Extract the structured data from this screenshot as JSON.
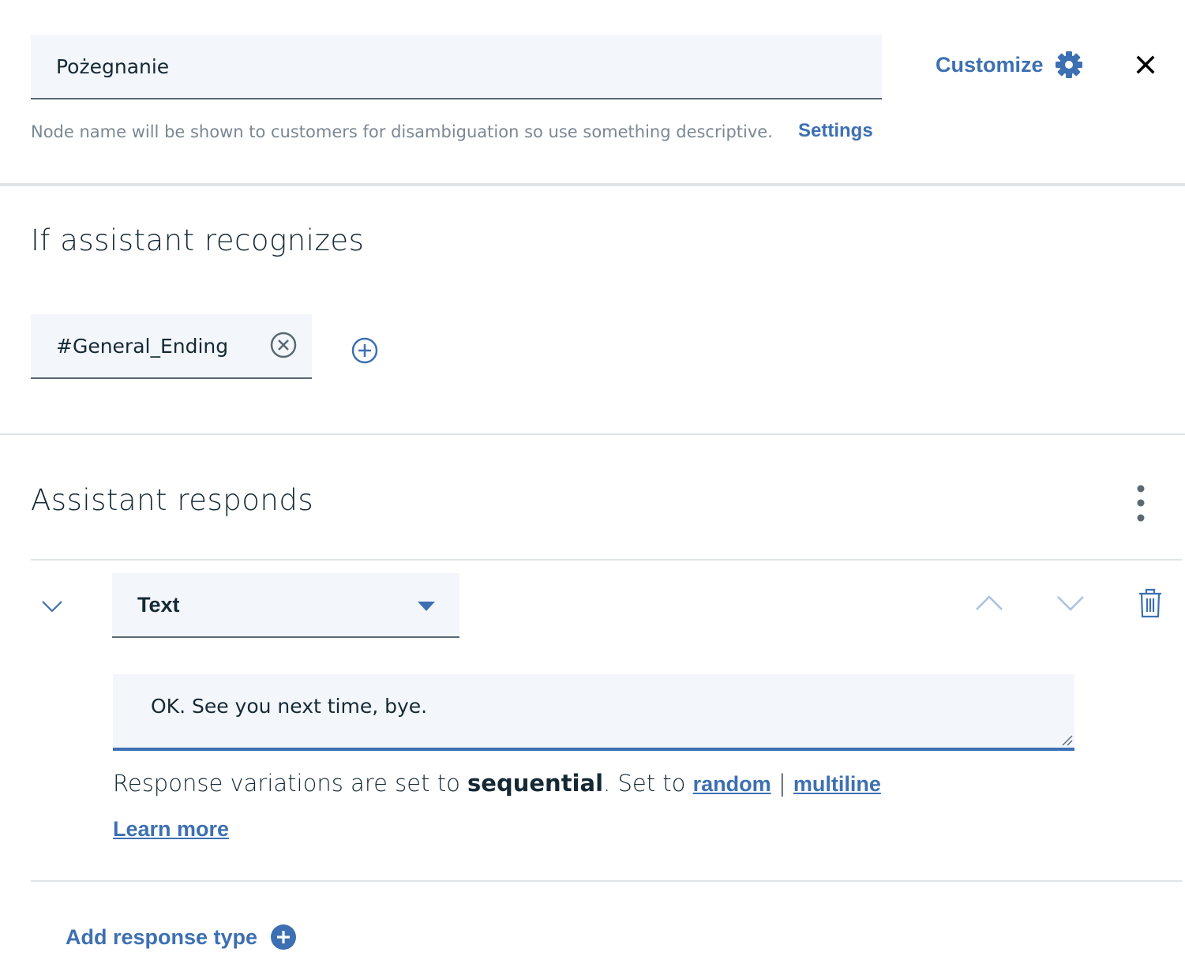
{
  "node": {
    "name_value": "Pożegnanie",
    "helper_text": "Node name will be shown to customers for disambiguation so use something descriptive.",
    "settings_label": "Settings",
    "customize_label": "Customize"
  },
  "recognizes": {
    "title": "If assistant recognizes",
    "conditions": [
      "#General_Ending"
    ]
  },
  "responds": {
    "title": "Assistant responds",
    "response_type": "Text",
    "response_value": "OK. See you next time, bye.",
    "variations_prefix": "Response variations are set to ",
    "variations_mode": "sequential",
    "variations_suffix": ". Set to ",
    "option_random": "random",
    "option_separator": " | ",
    "option_multiline": "multiline",
    "learn_more": "Learn more",
    "add_response_label": "Add response type"
  },
  "colors": {
    "accent": "#3d70b2",
    "field_bg": "#f3f6fa",
    "text": "#152935",
    "muted": "#7b8794",
    "divider": "#dfe3e6"
  },
  "icons": [
    "gear-icon",
    "close-icon",
    "remove-circle-icon",
    "add-circle-icon",
    "overflow-menu-icon",
    "chevron-down-icon",
    "caret-down-icon",
    "chevron-up-icon",
    "trash-icon",
    "add-filled-circle-icon"
  ]
}
